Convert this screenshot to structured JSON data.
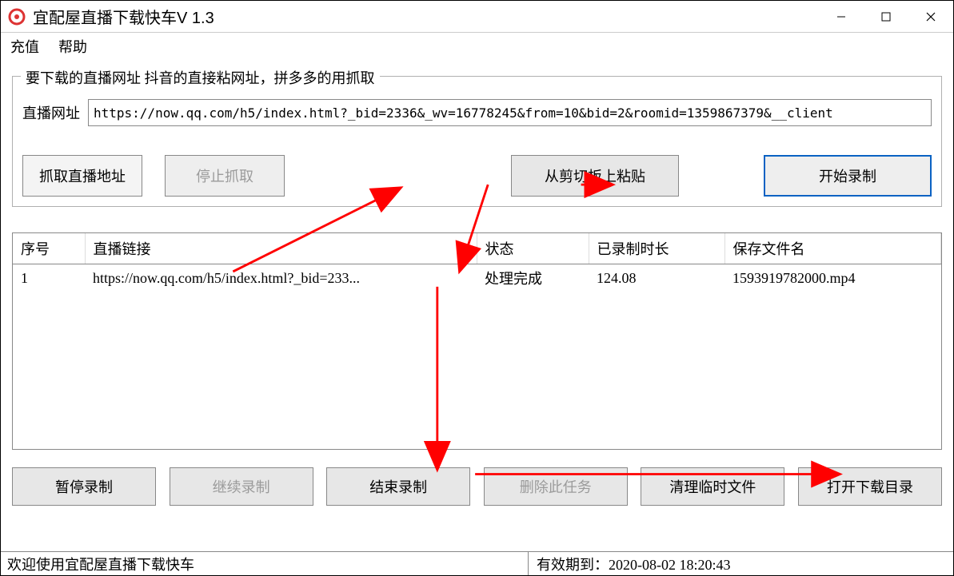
{
  "title": "宜配屋直播下载快车V 1.3",
  "menu": {
    "recharge": "充值",
    "help": "帮助"
  },
  "fieldset_legend": "要下载的直播网址 抖音的直接粘网址，拼多多的用抓取",
  "url_label": "直播网址",
  "url_value": "https://now.qq.com/h5/index.html?_bid=2336&_wv=16778245&from=10&bid=2&roomid=1359867379&__client",
  "buttons": {
    "capture": "抓取直播地址",
    "stop_capture": "停止抓取",
    "paste": "从剪切板上粘贴",
    "start_record": "开始录制",
    "pause_record": "暂停录制",
    "resume_record": "继续录制",
    "end_record": "结束录制",
    "delete_task": "删除此任务",
    "clear_temp": "清理临时文件",
    "open_dir": "打开下载目录"
  },
  "table": {
    "headers": {
      "no": "序号",
      "link": "直播链接",
      "status": "状态",
      "duration": "已录制时长",
      "filename": "保存文件名"
    },
    "rows": [
      {
        "no": "1",
        "link": "https://now.qq.com/h5/index.html?_bid=233...",
        "status": "处理完成",
        "duration": "124.08",
        "filename": "1593919782000.mp4"
      }
    ]
  },
  "status": {
    "left": "欢迎使用宜配屋直播下载快车",
    "right_label": "有效期到：",
    "right_value": "2020-08-02 18:20:43"
  }
}
